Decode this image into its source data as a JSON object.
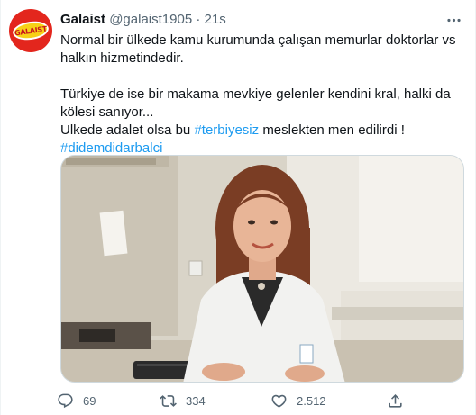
{
  "tweet": {
    "author_name": "Galaist",
    "author_handle": "@galaist1905",
    "separator": "·",
    "timestamp": "21s",
    "avatar_text": "GALAIST",
    "lines": [
      "Normal bir ülkede kamu kurumunda çalışan memurlar doktorlar vs halkın hizmetindedir.",
      "Türkiye de ise bir makama mevkiye gelenler kendini kral, halki da kölesi sanıyor...",
      "Ulkede adalet olsa bu",
      "#terbiyesiz",
      "meslekten men edilirdi !",
      "#didemdidarbalci"
    ]
  },
  "actions": {
    "reply_count": "69",
    "retweet_count": "334",
    "like_count": "2.512"
  },
  "icons": {
    "more": "more-icon",
    "reply": "reply-icon",
    "retweet": "retweet-icon",
    "like": "like-icon",
    "share": "share-icon"
  },
  "colors": {
    "link": "#1d9bf0",
    "secondary": "#536471",
    "text": "#0f1419",
    "avatar_red": "#e3261d",
    "avatar_yellow": "#f7d117"
  }
}
